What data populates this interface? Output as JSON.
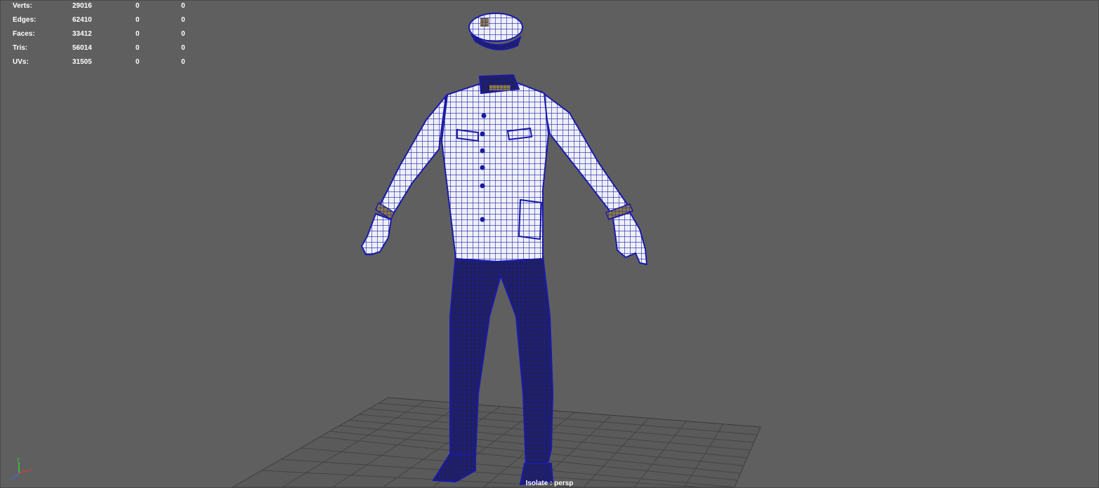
{
  "hud": {
    "rows": [
      {
        "label": "Verts:",
        "total": "29016",
        "selected": "0",
        "component": "0"
      },
      {
        "label": "Edges:",
        "total": "62410",
        "selected": "0",
        "component": "0"
      },
      {
        "label": "Faces:",
        "total": "33412",
        "selected": "0",
        "component": "0"
      },
      {
        "label": "Tris:",
        "total": "56014",
        "selected": "0",
        "component": "0"
      },
      {
        "label": "UVs:",
        "total": "31505",
        "selected": "0",
        "component": "0"
      }
    ]
  },
  "viewport": {
    "caption": "Isolate : persp",
    "background_color": "#5f5f5f",
    "wireframe_color": "#1a1aa8",
    "grid_color": "#3c3c3c"
  },
  "axis_gizmo": {
    "x": "x",
    "y": "y",
    "z": "z"
  }
}
